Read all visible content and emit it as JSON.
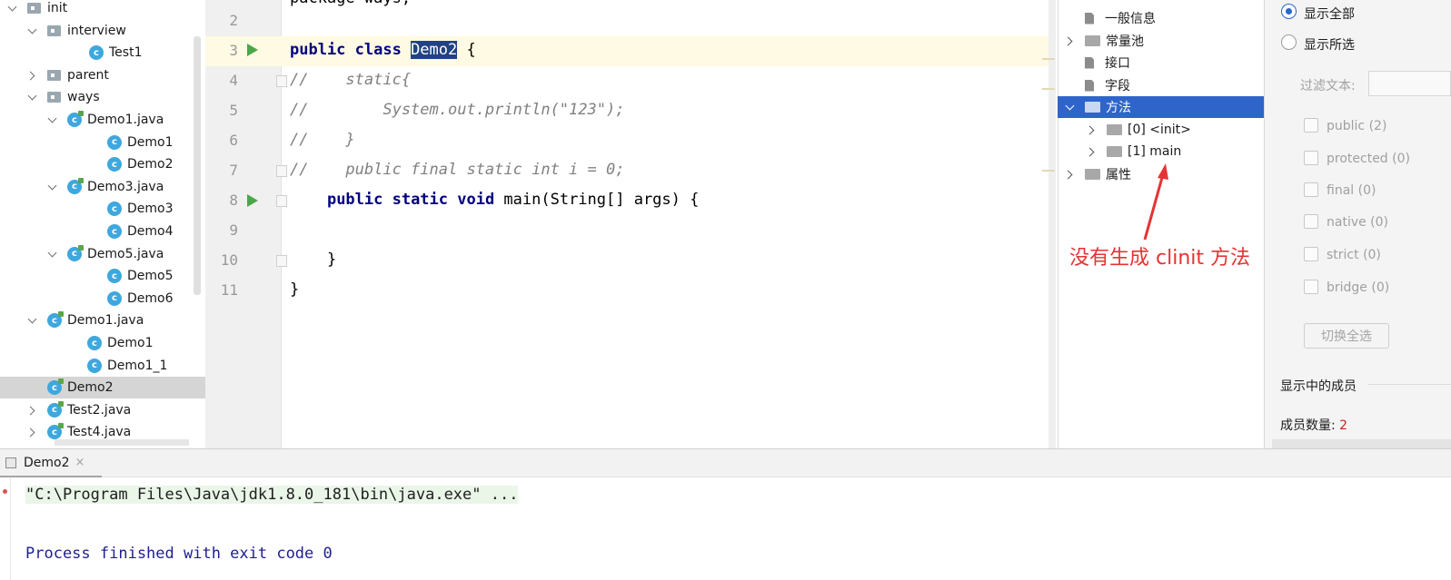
{
  "project_tree": {
    "items": [
      {
        "label": "init",
        "type": "folder",
        "chev": "down"
      },
      {
        "label": "interview",
        "type": "folder",
        "chev": "down"
      },
      {
        "label": "Test1",
        "type": "class",
        "chev": "none"
      },
      {
        "label": "parent",
        "type": "folder",
        "chev": "right"
      },
      {
        "label": "ways",
        "type": "folder",
        "chev": "down"
      },
      {
        "label": "Demo1.java",
        "type": "file",
        "chev": "down"
      },
      {
        "label": "Demo1",
        "type": "class",
        "chev": "none"
      },
      {
        "label": "Demo2",
        "type": "class",
        "chev": "none"
      },
      {
        "label": "Demo3.java",
        "type": "file",
        "chev": "down"
      },
      {
        "label": "Demo3",
        "type": "class",
        "chev": "none"
      },
      {
        "label": "Demo4",
        "type": "class",
        "chev": "none"
      },
      {
        "label": "Demo5.java",
        "type": "file",
        "chev": "down"
      },
      {
        "label": "Demo5",
        "type": "class",
        "chev": "none"
      },
      {
        "label": "Demo6",
        "type": "class",
        "chev": "none"
      },
      {
        "label": "Demo1.java",
        "type": "file",
        "chev": "down"
      },
      {
        "label": "Demo1",
        "type": "class",
        "chev": "none"
      },
      {
        "label": "Demo1_1",
        "type": "class",
        "chev": "none"
      },
      {
        "label": "Demo2",
        "type": "file",
        "chev": "none",
        "selected": true
      },
      {
        "label": "Test2.java",
        "type": "file",
        "chev": "right"
      },
      {
        "label": "Test4.java",
        "type": "file",
        "chev": "right"
      }
    ],
    "class_badge": "c"
  },
  "editor": {
    "line_numbers": [
      "2",
      "3",
      "4",
      "5",
      "6",
      "7",
      "8",
      "9",
      "10",
      "11"
    ],
    "top_cut_text": "package ways;",
    "code": {
      "l3_kw": "public class ",
      "l3_name": "Demo2",
      "l3_rest": " {",
      "l4": "//    static{",
      "l5": "//        System.out.println(\"123\");",
      "l6": "//    }",
      "l7": "//    public final static int i = 0;",
      "l8_indent": "    ",
      "l8_kw": "public static void ",
      "l8_rest": "main(String[] args) {",
      "l10": "    }",
      "l11": "}"
    }
  },
  "bytecode_tree": {
    "items": [
      {
        "label": "一般信息",
        "icon": "doc-icon",
        "chev": "none"
      },
      {
        "label": "常量池",
        "icon": "folder-icon",
        "chev": "right"
      },
      {
        "label": "接口",
        "icon": "doc-icon",
        "chev": "none"
      },
      {
        "label": "字段",
        "icon": "doc-icon",
        "chev": "none"
      },
      {
        "label": "方法",
        "icon": "folder-icon",
        "chev": "down",
        "active": true
      },
      {
        "label": "[0] <init>",
        "icon": "folder-icon",
        "chev": "right"
      },
      {
        "label": "[1] main",
        "icon": "folder-icon",
        "chev": "right"
      },
      {
        "label": "属性",
        "icon": "folder-icon",
        "chev": "right"
      }
    ],
    "annotation": "没有生成 clinit 方法",
    "annotation_color": "#e53333"
  },
  "filter_panel": {
    "show_all": "显示全部",
    "show_selected": "显示所选",
    "filter_text_label": "过滤文本:",
    "checkboxes": [
      "public (2)",
      "protected (0)",
      "final (0)",
      "native (0)",
      "strict (0)",
      "bridge (0)"
    ],
    "toggle_button": "切换全选",
    "shown_members_label": "显示中的成员",
    "member_count_label": "成员数量:",
    "member_count": "2"
  },
  "run_panel": {
    "tab_label": "Demo2",
    "tab_close": "×",
    "command_line": "\"C:\\Program Files\\Java\\jdk1.8.0_181\\bin\\java.exe\" ...",
    "exit_line": "Process finished with exit code 0"
  },
  "colors": {
    "selection_blue": "#2f65ca",
    "keyword": "#000080",
    "comment": "#808080",
    "run_green": "#4aa74a"
  }
}
